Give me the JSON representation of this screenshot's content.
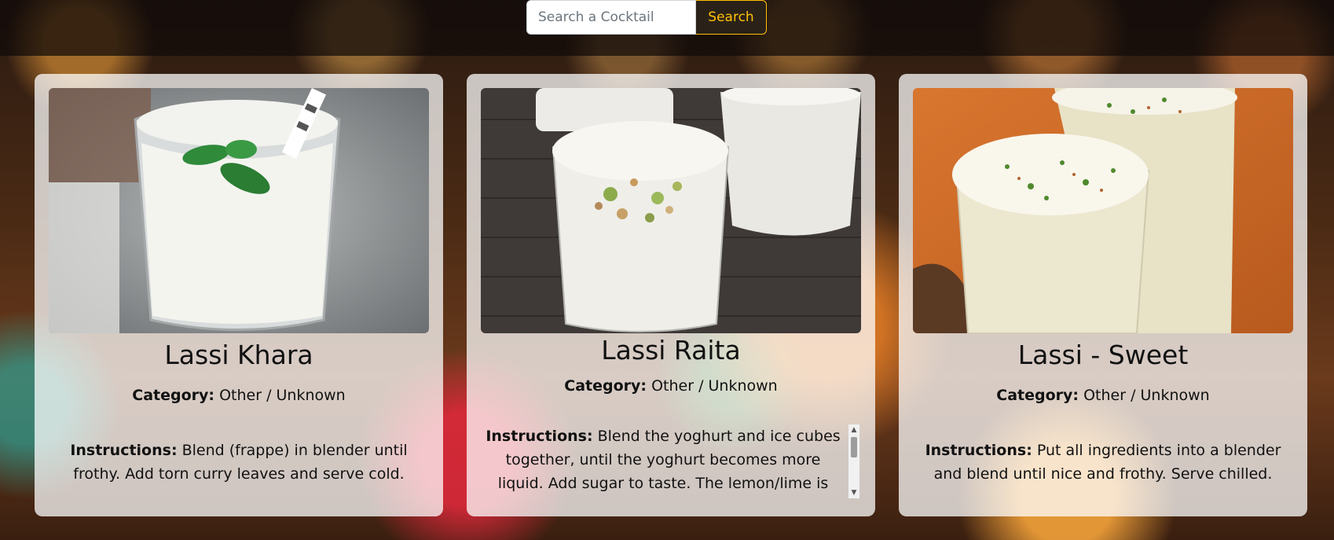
{
  "search": {
    "placeholder": "Search a Cocktail",
    "button_label": "Search"
  },
  "drinks": [
    {
      "name": "Lassi Khara",
      "category_label": "Category:",
      "category": "Other / Unknown",
      "instructions_label": "Instructions:",
      "instructions": "Blend (frappe) in blender until frothy. Add torn curry leaves and serve cold."
    },
    {
      "name": "Lassi Raita",
      "category_label": "Category:",
      "category": "Other / Unknown",
      "instructions_label": "Instructions:",
      "instructions": "Blend the yoghurt and ice cubes together, until the yoghurt becomes more liquid. Add sugar to taste. The lemon/lime is optional but"
    },
    {
      "name": "Lassi - Sweet",
      "category_label": "Category:",
      "category": "Other / Unknown",
      "instructions_label": "Instructions:",
      "instructions": "Put all ingredients into a blender and blend until nice and frothy. Serve chilled."
    }
  ],
  "colors": {
    "accent": "#ffc107",
    "card_background": "rgba(255,255,255,0.74)"
  }
}
